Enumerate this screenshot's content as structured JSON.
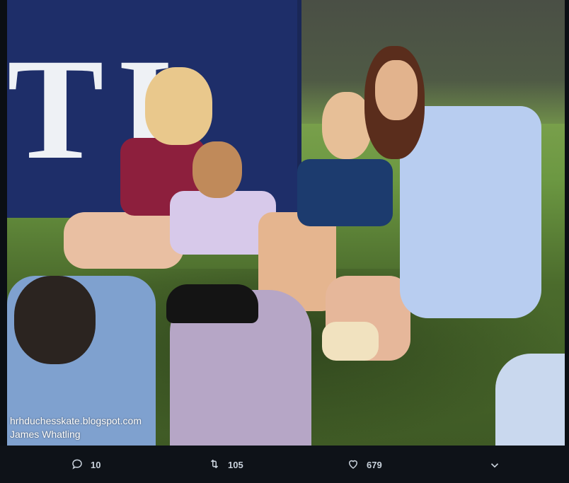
{
  "photo": {
    "sign_text": "TI",
    "watermark_line1": "hrhduchesskate.blogspot.com",
    "watermark_line2": "James Whatling"
  },
  "actions": {
    "reply": {
      "icon": "reply-icon",
      "count": "10"
    },
    "retweet": {
      "icon": "retweet-icon",
      "count": "105"
    },
    "like": {
      "icon": "heart-icon",
      "count": "679"
    },
    "more": {
      "icon": "chevron-down-icon"
    }
  }
}
